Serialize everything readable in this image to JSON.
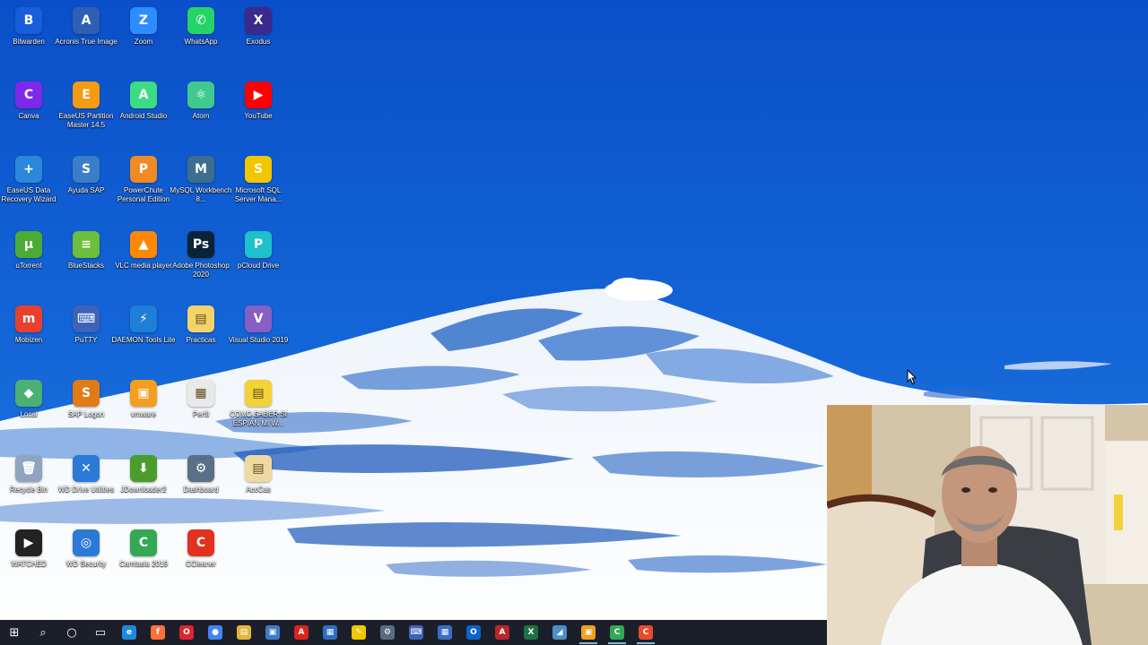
{
  "desktop": {
    "icons": [
      {
        "label": "Bitwarden",
        "glyph": "B",
        "color": "#175ddc",
        "icon": "bitwarden-icon"
      },
      {
        "label": "Acronis True Image",
        "glyph": "A",
        "color": "#2f5fb3",
        "icon": "acronis-icon"
      },
      {
        "label": "Zoom",
        "glyph": "Z",
        "color": "#2d8cff",
        "icon": "zoom-icon"
      },
      {
        "label": "WhatsApp",
        "glyph": "✆",
        "color": "#25d366",
        "icon": "whatsapp-icon"
      },
      {
        "label": "Exodus",
        "glyph": "X",
        "color": "#3b2a8c",
        "icon": "exodus-icon"
      },
      {
        "label": "Canva",
        "glyph": "C",
        "color": "#7d2ae8",
        "icon": "canva-icon"
      },
      {
        "label": "EaseUS Partition Master 14.5",
        "glyph": "E",
        "color": "#f39c12",
        "icon": "easeus-partition-icon"
      },
      {
        "label": "Android Studio",
        "glyph": "A",
        "color": "#3ddc84",
        "icon": "android-studio-icon"
      },
      {
        "label": "Atom",
        "glyph": "⚛",
        "color": "#40c98e",
        "icon": "atom-icon"
      },
      {
        "label": "YouTube",
        "glyph": "▶",
        "color": "#ff0000",
        "icon": "youtube-icon"
      },
      {
        "label": "EaseUS Data Recovery Wizard",
        "glyph": "+",
        "color": "#2b87d9",
        "icon": "easeus-recovery-icon"
      },
      {
        "label": "Ayuda SAP",
        "glyph": "S",
        "color": "#3a7ec9",
        "icon": "sap-help-icon"
      },
      {
        "label": "PowerChute Personal Edition",
        "glyph": "P",
        "color": "#f08a24",
        "icon": "powerchute-icon"
      },
      {
        "label": "MySQL Workbench 8...",
        "glyph": "M",
        "color": "#3e6e8f",
        "icon": "mysql-icon"
      },
      {
        "label": "Microsoft SQL Server Mana...",
        "glyph": "S",
        "color": "#f2c600",
        "icon": "sql-server-icon"
      },
      {
        "label": "uTorrent",
        "glyph": "µ",
        "color": "#4cab36",
        "icon": "utorrent-icon"
      },
      {
        "label": "BlueStacks",
        "glyph": "≡",
        "color": "#6cbf3a",
        "icon": "bluestacks-icon"
      },
      {
        "label": "VLC media player",
        "glyph": "▲",
        "color": "#ff8800",
        "icon": "vlc-icon"
      },
      {
        "label": "Adobe Photoshop 2020",
        "glyph": "Ps",
        "color": "#0b2339",
        "icon": "photoshop-icon"
      },
      {
        "label": "pCloud Drive",
        "glyph": "P",
        "color": "#1cc1c9",
        "icon": "pcloud-icon"
      },
      {
        "label": "Mobizen",
        "glyph": "m",
        "color": "#e8402c",
        "icon": "mobizen-icon"
      },
      {
        "label": "PuTTY",
        "glyph": "⌨",
        "color": "#3d63b8",
        "icon": "putty-icon"
      },
      {
        "label": "DAEMON Tools Lite",
        "glyph": "⚡",
        "color": "#1e7fd8",
        "icon": "daemon-tools-icon"
      },
      {
        "label": "Practicas",
        "glyph": "▤",
        "color": "#f3d36b",
        "icon": "folder-icon"
      },
      {
        "label": "Visual Studio 2019",
        "glyph": "V",
        "color": "#865fc5",
        "icon": "visual-studio-icon"
      },
      {
        "label": "Local",
        "glyph": "◆",
        "color": "#4caf74",
        "icon": "local-icon"
      },
      {
        "label": "SAP Logon",
        "glyph": "S",
        "color": "#e07b16",
        "icon": "sap-logon-icon"
      },
      {
        "label": "vmware",
        "glyph": "▣",
        "color": "#f29e1f",
        "icon": "vmware-icon"
      },
      {
        "label": "Perfil",
        "glyph": "▦",
        "color": "#e9e9e9",
        "icon": "document-icon"
      },
      {
        "label": "COMO SABER SI ESPIAN MI W...",
        "glyph": "▤",
        "color": "#f2d236",
        "icon": "folder-icon"
      },
      {
        "label": "Recycle Bin",
        "glyph": "🗑",
        "color": "#8fa5bf",
        "icon": "recycle-bin-icon"
      },
      {
        "label": "WD Drive Utilities",
        "glyph": "✕",
        "color": "#2c7ad6",
        "icon": "wd-drive-icon"
      },
      {
        "label": "JDownloader2",
        "glyph": "⬇",
        "color": "#4a9d2b",
        "icon": "jdownloader-icon"
      },
      {
        "label": "Dashboard",
        "glyph": "⚙",
        "color": "#5b6f86",
        "icon": "dashboard-icon"
      },
      {
        "label": "AccCas",
        "glyph": "▤",
        "color": "#f0d9a0",
        "icon": "folder-icon"
      },
      {
        "label": "WATCHED",
        "glyph": "▶",
        "color": "#222222",
        "icon": "watched-icon"
      },
      {
        "label": "WD Security",
        "glyph": "◎",
        "color": "#2c7ad6",
        "icon": "wd-security-icon"
      },
      {
        "label": "Camtasia 2019",
        "glyph": "C",
        "color": "#34a853",
        "icon": "camtasia-icon"
      },
      {
        "label": "CCleaner",
        "glyph": "C",
        "color": "#e0321e",
        "icon": "ccleaner-icon"
      }
    ]
  },
  "taskbar": {
    "items": [
      {
        "glyph": "⊞",
        "color": "#1b1f2a",
        "icon": "windows-start-icon",
        "active": false
      },
      {
        "glyph": "⌕",
        "color": "#1b1f2a",
        "icon": "search-icon",
        "active": false
      },
      {
        "glyph": "○",
        "color": "#1b1f2a",
        "icon": "cortana-icon",
        "active": false
      },
      {
        "glyph": "▭",
        "color": "#1b1f2a",
        "icon": "task-view-icon",
        "active": false
      },
      {
        "glyph": "e",
        "color": "#1c8ad8",
        "icon": "edge-icon",
        "active": false
      },
      {
        "glyph": "f",
        "color": "#ff7139",
        "icon": "firefox-icon",
        "active": false
      },
      {
        "glyph": "O",
        "color": "#e0242e",
        "icon": "opera-icon",
        "active": false
      },
      {
        "glyph": "●",
        "color": "#4285f4",
        "icon": "chrome-icon",
        "active": false
      },
      {
        "glyph": "▤",
        "color": "#e4b53a",
        "icon": "file-explorer-icon",
        "active": false
      },
      {
        "glyph": "▣",
        "color": "#3e7cc4",
        "icon": "store-icon",
        "active": false
      },
      {
        "glyph": "A",
        "color": "#d8261d",
        "icon": "acrobat-icon",
        "active": false
      },
      {
        "glyph": "▦",
        "color": "#2b6fc2",
        "icon": "remote-desktop-icon",
        "active": false
      },
      {
        "glyph": "✎",
        "color": "#f2c600",
        "icon": "sticky-notes-icon",
        "active": false
      },
      {
        "glyph": "⚙",
        "color": "#5a6c80",
        "icon": "tools-icon",
        "active": false
      },
      {
        "glyph": "⌨",
        "color": "#3d63b8",
        "icon": "putty-icon",
        "active": false
      },
      {
        "glyph": "▦",
        "color": "#3b6dc7",
        "icon": "calculator-icon",
        "active": false
      },
      {
        "glyph": "O",
        "color": "#0a64c6",
        "icon": "outlook-icon",
        "active": false
      },
      {
        "glyph": "A",
        "color": "#b7272c",
        "icon": "access-icon",
        "active": false
      },
      {
        "glyph": "X",
        "color": "#1e7145",
        "icon": "excel-icon",
        "active": false
      },
      {
        "glyph": "◢",
        "color": "#4a8fc7",
        "icon": "notepad-icon",
        "active": false
      },
      {
        "glyph": "▣",
        "color": "#f29e1f",
        "icon": "vmware-icon",
        "active": true
      },
      {
        "glyph": "C",
        "color": "#34a853",
        "icon": "camtasia-icon",
        "active": true
      },
      {
        "glyph": "C",
        "color": "#e74c2a",
        "icon": "camtasia-recorder-icon",
        "active": true
      }
    ]
  }
}
